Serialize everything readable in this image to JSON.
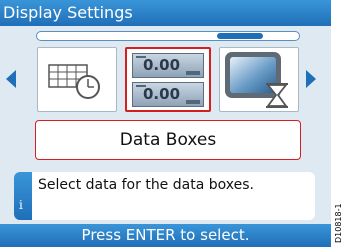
{
  "title": "Display Settings",
  "carousel": {
    "options": [
      {
        "name": "Time",
        "icon": "table-clock-icon"
      },
      {
        "name": "Data Boxes",
        "icon": "data-boxes-icon",
        "selected": true,
        "box_values": [
          "0.00",
          "0.00"
        ]
      },
      {
        "name": "Screen timeout",
        "icon": "screen-hourglass-icon"
      }
    ]
  },
  "selected_name": "Data Boxes",
  "info_text": "Select data for the data boxes.",
  "info_icon_glyph": "i",
  "footer_text": "Press ENTER to select.",
  "figure_code": "D10818-1",
  "colors": {
    "accent": "#1f6fb8",
    "selection": "#d22020",
    "background": "#dfe9f1"
  }
}
